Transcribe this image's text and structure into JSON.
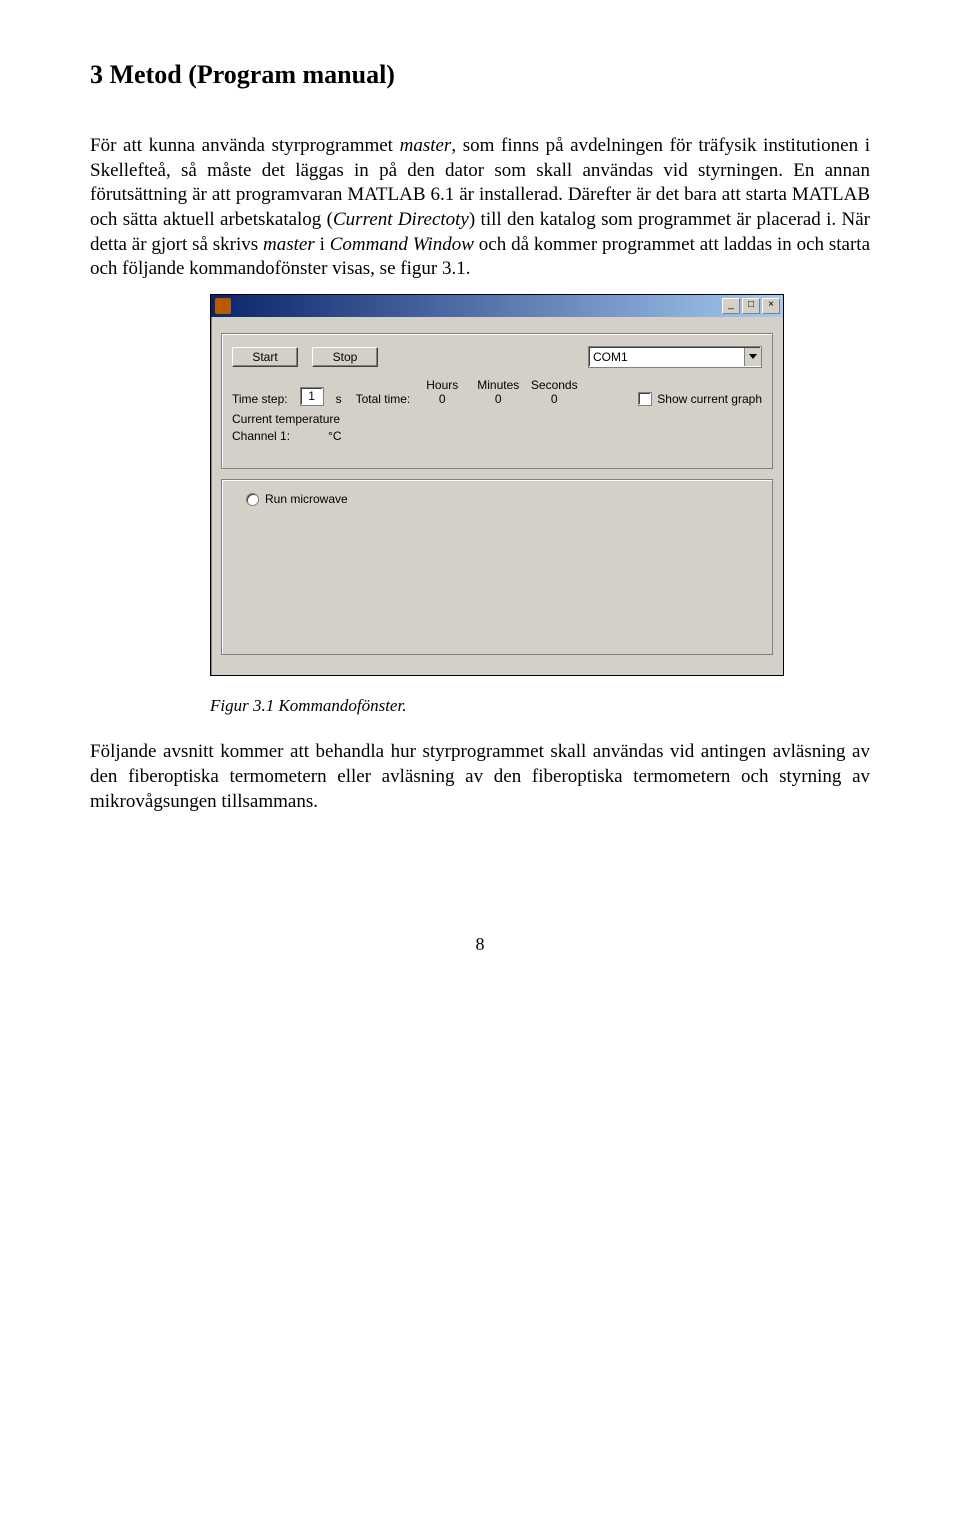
{
  "heading": "3 Metod (Program manual)",
  "p1_a": "För att kunna använda styrprogrammet ",
  "p1_b": "master",
  "p1_c": ", som finns på avdelningen för träfysik institutionen i Skellefteå, så måste det läggas in på den dator som skall användas vid styrningen. En annan förutsättning är att programvaran MATLAB 6.1 är installerad. Därefter är det bara att starta MATLAB och sätta aktuell arbetskatalog (",
  "p1_d": "Current Directoty",
  "p1_e": ") till den katalog som programmet är placerad i. När detta är gjort så skrivs ",
  "p1_f": "master",
  "p1_g": " i ",
  "p1_h": "Command Window",
  "p1_i": " och då kommer programmet att laddas in och starta och följande kommandofönster visas, se figur 3.1.",
  "fig": {
    "buttons": {
      "start": "Start",
      "stop": "Stop"
    },
    "combo": {
      "value": "COM1"
    },
    "labels": {
      "time_step": "Time step:",
      "s": "s",
      "total_time": "Total time:",
      "hours": "Hours",
      "minutes": "Minutes",
      "seconds": "Seconds",
      "show_graph": "Show current graph",
      "cur_temp": "Current temperature",
      "channel1": "Channel 1:",
      "degc": "°C",
      "run_microwave": "Run microwave"
    },
    "values": {
      "time_step": "1",
      "hours": "0",
      "minutes": "0",
      "seconds": "0"
    }
  },
  "caption": "Figur 3.1 Kommandofönster.",
  "p2": "Följande avsnitt kommer att behandla hur styrprogrammet skall användas vid antingen avläsning av den fiberoptiska termometern eller avläsning av den fiberoptiska termometern och styrning av mikrovågsungen tillsammans.",
  "page_number": "8"
}
